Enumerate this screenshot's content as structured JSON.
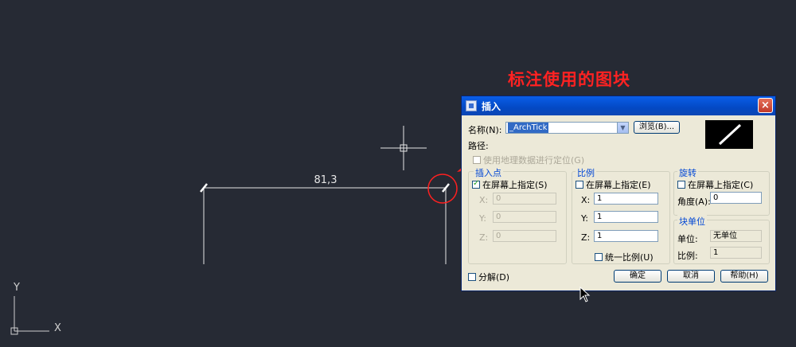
{
  "annotation": {
    "text": "标注使用的图块"
  },
  "drawing": {
    "dimension_text": "81,3",
    "ucs": {
      "x_label": "X",
      "y_label": "Y"
    }
  },
  "dialog": {
    "title": "插入",
    "close_label": "×",
    "name_label": "名称(N):",
    "name_value": "_ArchTick",
    "browse_label": "浏览(B)...",
    "path_label": "路径:",
    "geo_checkbox_label": "使用地理数据进行定位(G)",
    "insert_point": {
      "title": "插入点",
      "specify_label": "在屏幕上指定(S)",
      "specify_checked": true,
      "x_label": "X:",
      "x_value": "0",
      "y_label": "Y:",
      "y_value": "0",
      "z_label": "Z:",
      "z_value": "0"
    },
    "scale": {
      "title": "比例",
      "specify_label": "在屏幕上指定(E)",
      "specify_checked": false,
      "x_label": "X:",
      "x_value": "1",
      "y_label": "Y:",
      "y_value": "1",
      "z_label": "Z:",
      "z_value": "1",
      "uniform_label": "统一比例(U)"
    },
    "rotation": {
      "title": "旋转",
      "specify_label": "在屏幕上指定(C)",
      "angle_label": "角度(A):",
      "angle_value": "0"
    },
    "block_unit": {
      "title": "块单位",
      "unit_label": "单位:",
      "unit_value": "无单位",
      "factor_label": "比例:",
      "factor_value": "1"
    },
    "explode_label": "分解(D)",
    "ok_label": "确定",
    "cancel_label": "取消",
    "help_label": "帮助(H)"
  },
  "colors": {
    "canvas": "#262a34",
    "annotation": "#ff2222",
    "dialog_bg": "#ece9d8",
    "titlebar": "#0349c4"
  }
}
